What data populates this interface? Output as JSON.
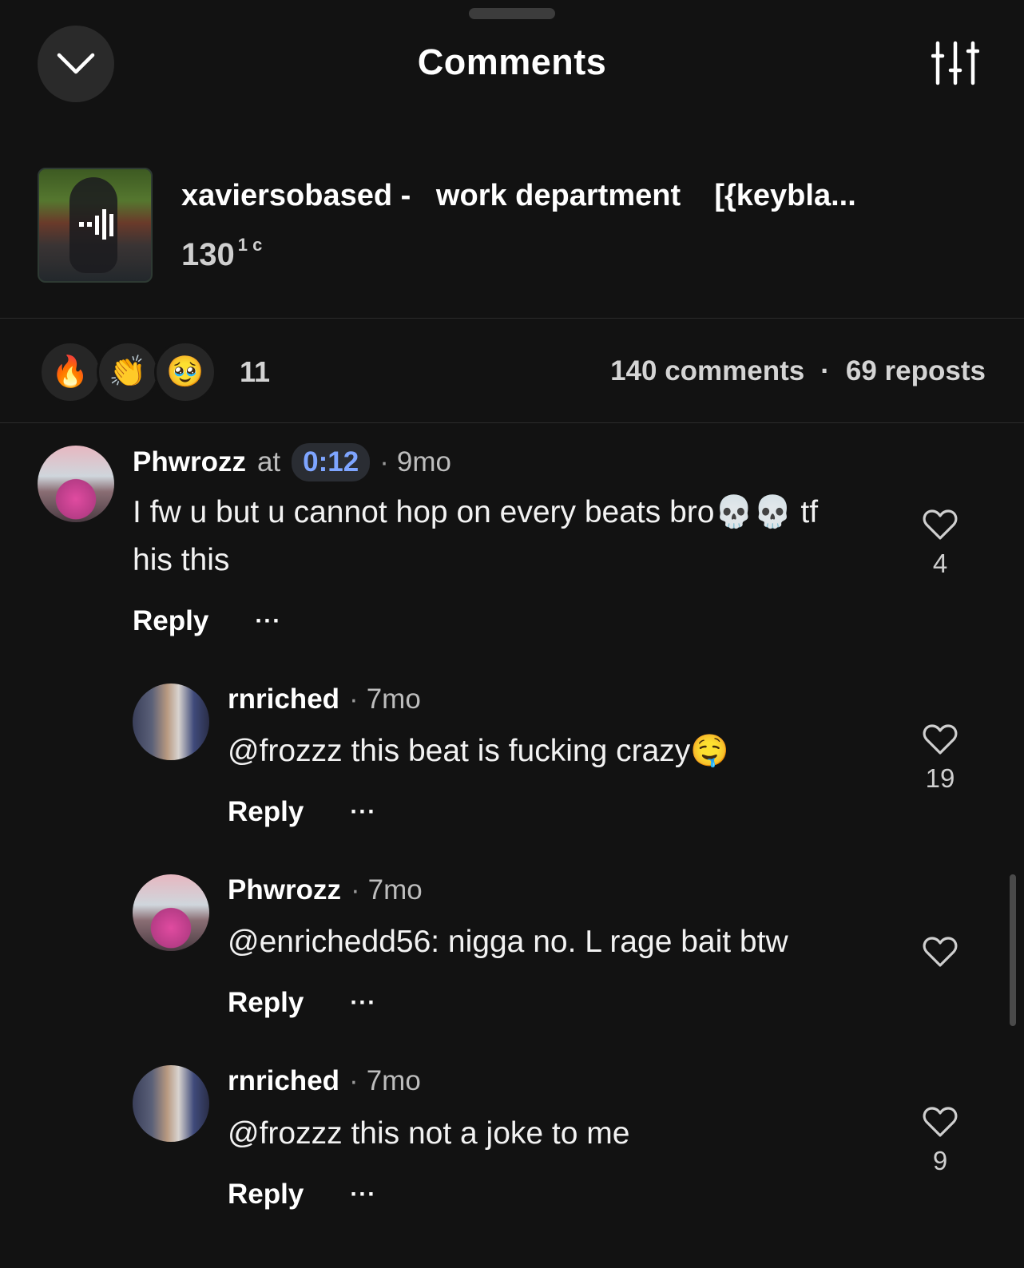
{
  "header": {
    "title": "Comments",
    "collapse_icon": "chevron-down-icon",
    "filter_icon": "sliders-icon"
  },
  "track": {
    "title": "xaviersobased -   work department    [{keybla...",
    "plays": "130",
    "plays_suffix": "1 c"
  },
  "reactions": {
    "emojis": [
      "🔥",
      "👏",
      "🥹"
    ],
    "count": "11"
  },
  "stats": {
    "comments": "140 comments",
    "separator": "·",
    "reposts": "69 reposts"
  },
  "comments": [
    {
      "user": "Phwrozz",
      "at_label": "at",
      "timestamp": "0:12",
      "age": "9mo",
      "text": "I fw u but u cannot hop on every beats bro💀💀 tf his this",
      "likes": "4",
      "reply_label": "Reply",
      "more_label": "···"
    },
    {
      "user": "rnriched",
      "age": "7mo",
      "text": "@frozzz this beat is fucking crazy🤤",
      "likes": "19",
      "reply_label": "Reply",
      "more_label": "···"
    },
    {
      "user": "Phwrozz",
      "age": "7mo",
      "text": "@enrichedd56: nigga no. L rage bait btw",
      "likes": "",
      "reply_label": "Reply",
      "more_label": "···"
    },
    {
      "user": "rnriched",
      "age": "7mo",
      "text": "@frozzz this not a joke to me",
      "likes": "9",
      "reply_label": "Reply",
      "more_label": "···"
    }
  ],
  "colors": {
    "background": "#121212",
    "accent_timestamp": "#7ea5ff",
    "text_secondary": "#bdbdbd"
  }
}
